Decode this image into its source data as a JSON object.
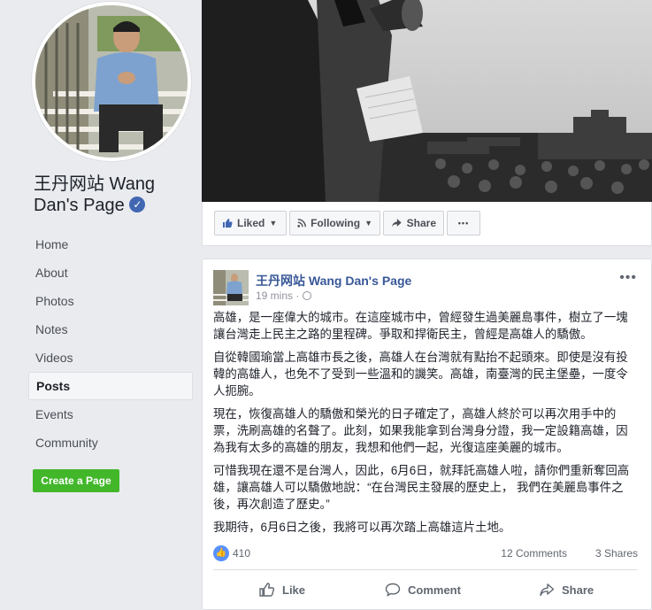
{
  "page": {
    "name": "王丹网站 Wang Dan's Page"
  },
  "nav": [
    {
      "label": "Home"
    },
    {
      "label": "About"
    },
    {
      "label": "Photos"
    },
    {
      "label": "Notes"
    },
    {
      "label": "Videos"
    },
    {
      "label": "Posts"
    },
    {
      "label": "Events"
    },
    {
      "label": "Community"
    }
  ],
  "create_page_label": "Create a Page",
  "actions": {
    "liked": "Liked",
    "following": "Following",
    "share": "Share",
    "more": "•••"
  },
  "post": {
    "author": "王丹网站 Wang Dan's Page",
    "time": "19 mins ·",
    "more": "•••",
    "paragraphs": [
      "高雄，是一座偉大的城市。在這座城市中，曾經發生過美麗島事件，樹立了一塊讓台灣走上民主之路的里程碑。爭取和捍衛民主，曾經是高雄人的驕傲。",
      "自從韓國瑜當上高雄市長之後，高雄人在台灣就有點抬不起頭來。即使是沒有投韓的高雄人，也免不了受到一些溫和的譏笑。高雄，南臺灣的民主堡壘，一度令人扼腕。",
      "現在，恢復高雄人的驕傲和榮光的日子確定了，高雄人終於可以再次用手中的票，洗刷高雄的名聲了。此刻，如果我能拿到台灣身分證，我一定設籍高雄，因為我有太多的高雄的朋友，我想和他們一起，光復這座美麗的城市。",
      "可惜我現在還不是台灣人，因此，6月6日，就拜託高雄人啦，請你們重新奪回高雄，讓高雄人可以驕傲地說：“在台灣民主發展的歷史上， 我們在美麗島事件之後，再次創造了歷史。”",
      "我期待，6月6日之後，我將可以再次踏上高雄這片土地。"
    ],
    "reaction_count": "410",
    "comments": "12 Comments",
    "shares": "3 Shares",
    "like_label": "Like",
    "comment_label": "Comment",
    "share_label": "Share"
  },
  "colors": {
    "background": "#e9ebee",
    "link": "#385898",
    "create_button": "#42b72a",
    "verified": "#4267b2",
    "like_badge": "#5890ff"
  }
}
